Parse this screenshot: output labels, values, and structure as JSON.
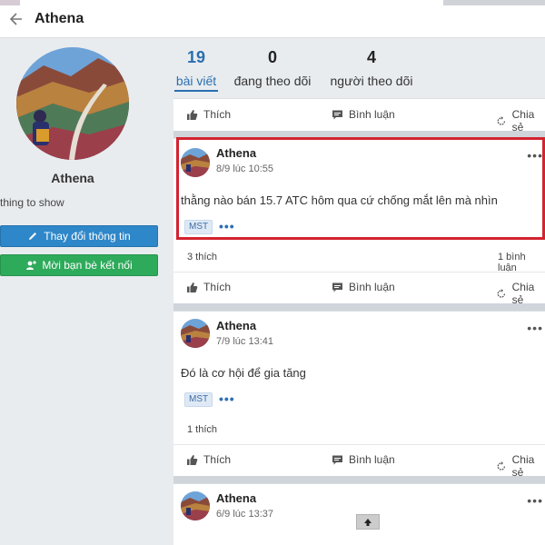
{
  "header": {
    "title": "Athena"
  },
  "profile": {
    "name": "Athena",
    "bio": "thing to show",
    "edit_button": "Thay đổi thông tin",
    "invite_button": "Mời bạn bè kết nối"
  },
  "stats": [
    {
      "value": "19",
      "label": "bài viết"
    },
    {
      "value": "0",
      "label": "đang theo dõi"
    },
    {
      "value": "4",
      "label": "người theo dõi"
    }
  ],
  "actions": {
    "like": "Thích",
    "comment": "Bình luận",
    "share": "Chia sẻ"
  },
  "posts": [
    {
      "author": "Athena",
      "time": "8/9 lúc 10:55",
      "text": "thằng nào bán 15.7 ATC hôm qua cứ chống mắt lên mà nhìn",
      "tag": "MST",
      "likes": "3 thích",
      "comments": "1 bình luận"
    },
    {
      "author": "Athena",
      "time": "7/9 lúc 13:41",
      "text": "Đó là cơ hội để gia tăng",
      "tag": "MST",
      "likes": "1 thích"
    },
    {
      "author": "Athena",
      "time": "6/9 lúc 13:37"
    }
  ],
  "more_symbol": "•••",
  "colors": {
    "accent": "#2a6fb0",
    "edit_button": "#2e87c9",
    "invite_button": "#2eaa5b",
    "highlight": "#d3232f"
  }
}
